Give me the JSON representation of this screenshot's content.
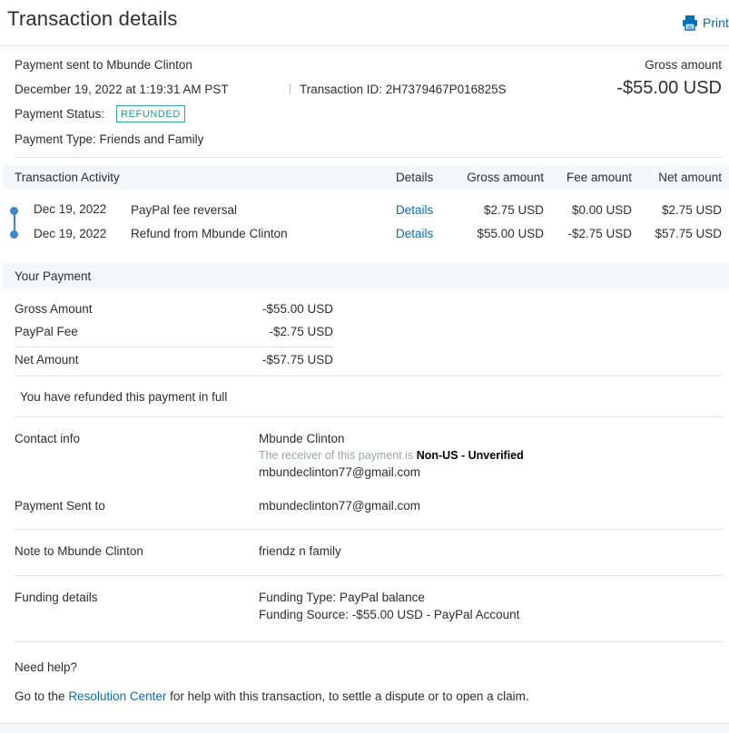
{
  "header": {
    "title": "Transaction details",
    "print_label": "Print"
  },
  "summary": {
    "sent_to": "Payment sent to Mbunde Clinton",
    "date": "December 19, 2022 at 1:19:31 AM PST",
    "transaction_id": "Transaction ID: 2H7379467P016825S",
    "status_label": "Payment Status:",
    "status_badge": "REFUNDED",
    "payment_type": "Payment Type: Friends and Family",
    "gross_label": "Gross amount",
    "gross_value": "-$55.00 USD"
  },
  "activity": {
    "title": "Transaction Activity",
    "columns": {
      "details": "Details",
      "gross": "Gross amount",
      "fee": "Fee amount",
      "net": "Net amount"
    },
    "rows": [
      {
        "date": "Dec 19, 2022",
        "description": "PayPal fee reversal",
        "details": "Details",
        "gross": "$2.75 USD",
        "fee": "$0.00 USD",
        "net": "$2.75 USD"
      },
      {
        "date": "Dec 19, 2022",
        "description": "Refund from Mbunde Clinton",
        "details": "Details",
        "gross": "$55.00 USD",
        "fee": "-$2.75 USD",
        "net": "$57.75 USD"
      }
    ]
  },
  "your_payment": {
    "title": "Your Payment",
    "gross_label": "Gross Amount",
    "gross_value": "-$55.00 USD",
    "fee_label": "PayPal Fee",
    "fee_value": "-$2.75 USD",
    "net_label": "Net Amount",
    "net_value": "-$57.75 USD",
    "refund_note": "You have refunded this payment in full"
  },
  "contact": {
    "label": "Contact info",
    "name": "Mbunde Clinton",
    "receiver_note": "The receiver of this payment is",
    "receiver_status": "Non-US - Unverified",
    "email": "mbundeclinton77@gmail.com"
  },
  "sent_to": {
    "label": "Payment Sent to",
    "value": "mbundeclinton77@gmail.com"
  },
  "note": {
    "label": "Note to Mbunde Clinton",
    "value": "friendz n family"
  },
  "funding": {
    "label": "Funding details",
    "type": "Funding Type: PayPal balance",
    "source": "Funding Source: -$55.00 USD - PayPal Account"
  },
  "help": {
    "title": "Need help?",
    "prefix": "Go to the",
    "link": "Resolution Center",
    "suffix": "for help with this transaction, to settle a dispute or to open a claim."
  },
  "colors": {
    "link": "#0070ba",
    "badge": "#1b9891",
    "timeline": "#3b87c8",
    "band": "#f5f7fa"
  }
}
